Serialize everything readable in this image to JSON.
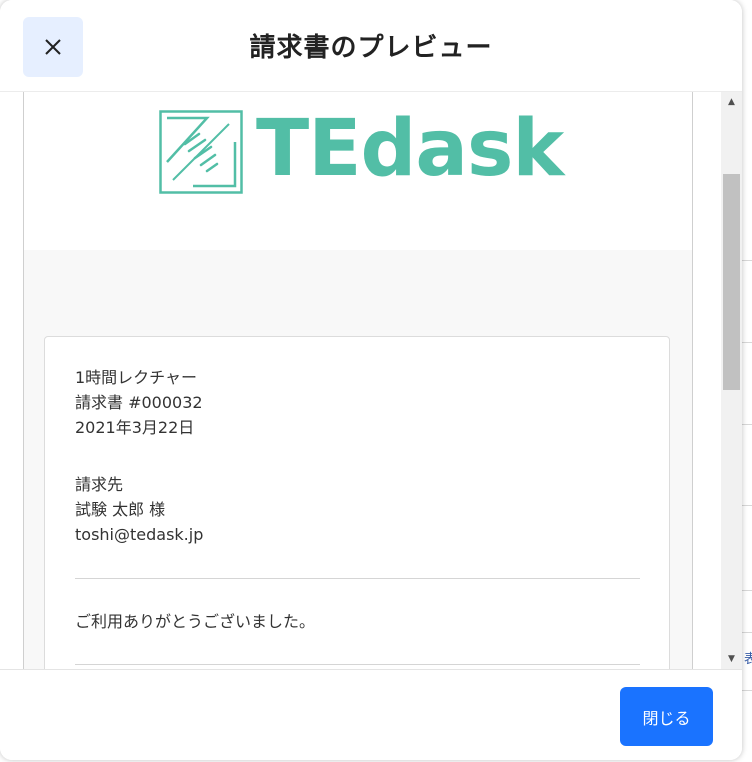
{
  "modal": {
    "title": "請求書のプレビュー",
    "close_icon": "close-icon",
    "footer_button_label": "閉じる"
  },
  "brand": {
    "logo_text": "TEdask",
    "accent_color": "#52bea6"
  },
  "invoice": {
    "product": "1時間レクチャー",
    "number": "請求書 #000032",
    "date": "2021年3月22日",
    "bill_to_label": "請求先",
    "customer_name": "試験 太郎 様",
    "customer_email": "toshi@tedask.jp",
    "thanks_message": "ご利用ありがとうございました。"
  },
  "background": {
    "fragment_text": "表"
  },
  "colors": {
    "primary_button": "#1a73ff",
    "close_button_bg": "#e6efff"
  }
}
